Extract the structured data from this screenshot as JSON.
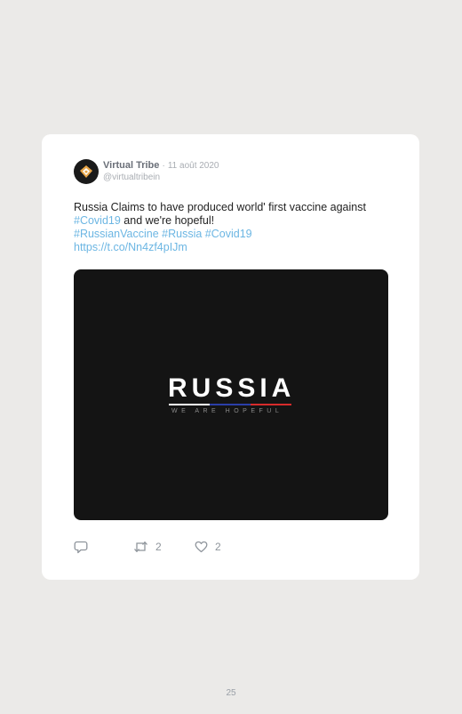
{
  "tweet": {
    "display_name": "Virtual Tribe",
    "separator": "·",
    "date": "11 août 2020",
    "handle": "@virtualtribein",
    "text_before": "Russia Claims to have produced world' first vaccine against",
    "hashtag_covid": "#Covid19",
    "text_after": " and we're hopeful!",
    "hashtag_russian_vaccine": "#RussianVaccine",
    "hashtag_russia": "#Russia",
    "hashtag_covid_2": "#Covid19",
    "link": "https://t.co/Nn4zf4pIJm",
    "media": {
      "headline": "RUSSIA",
      "tagline": "WE ARE HOPEFUL",
      "flag_colors": [
        "#ffffff",
        "#2b3fa8",
        "#d62b2b"
      ]
    },
    "actions": {
      "reply_icon": "reply-icon",
      "retweet_icon": "retweet-icon",
      "retweet_count": "2",
      "like_icon": "heart-icon",
      "like_count": "2"
    }
  },
  "page_number": "25",
  "colors": {
    "background": "#ebeae8",
    "card": "#ffffff",
    "link": "#6cb6e3",
    "muted": "#a9adb3"
  }
}
